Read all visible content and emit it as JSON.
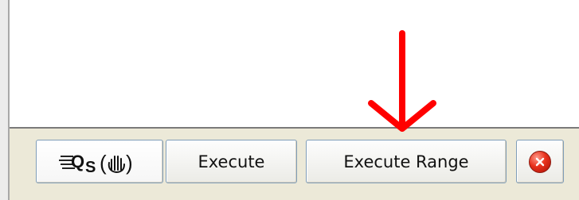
{
  "toolbar": {
    "logo_label": "QS",
    "execute_label": "Execute",
    "execute_range_label": "Execute Range"
  },
  "icons": {
    "logo": "qs-hand-logo-icon",
    "close": "close-icon",
    "arrow": "red-down-arrow-annotation"
  },
  "colors": {
    "annotation_arrow": "#ff0000",
    "close_icon": "#e8311c",
    "toolbar_background": "#ece9d8"
  }
}
